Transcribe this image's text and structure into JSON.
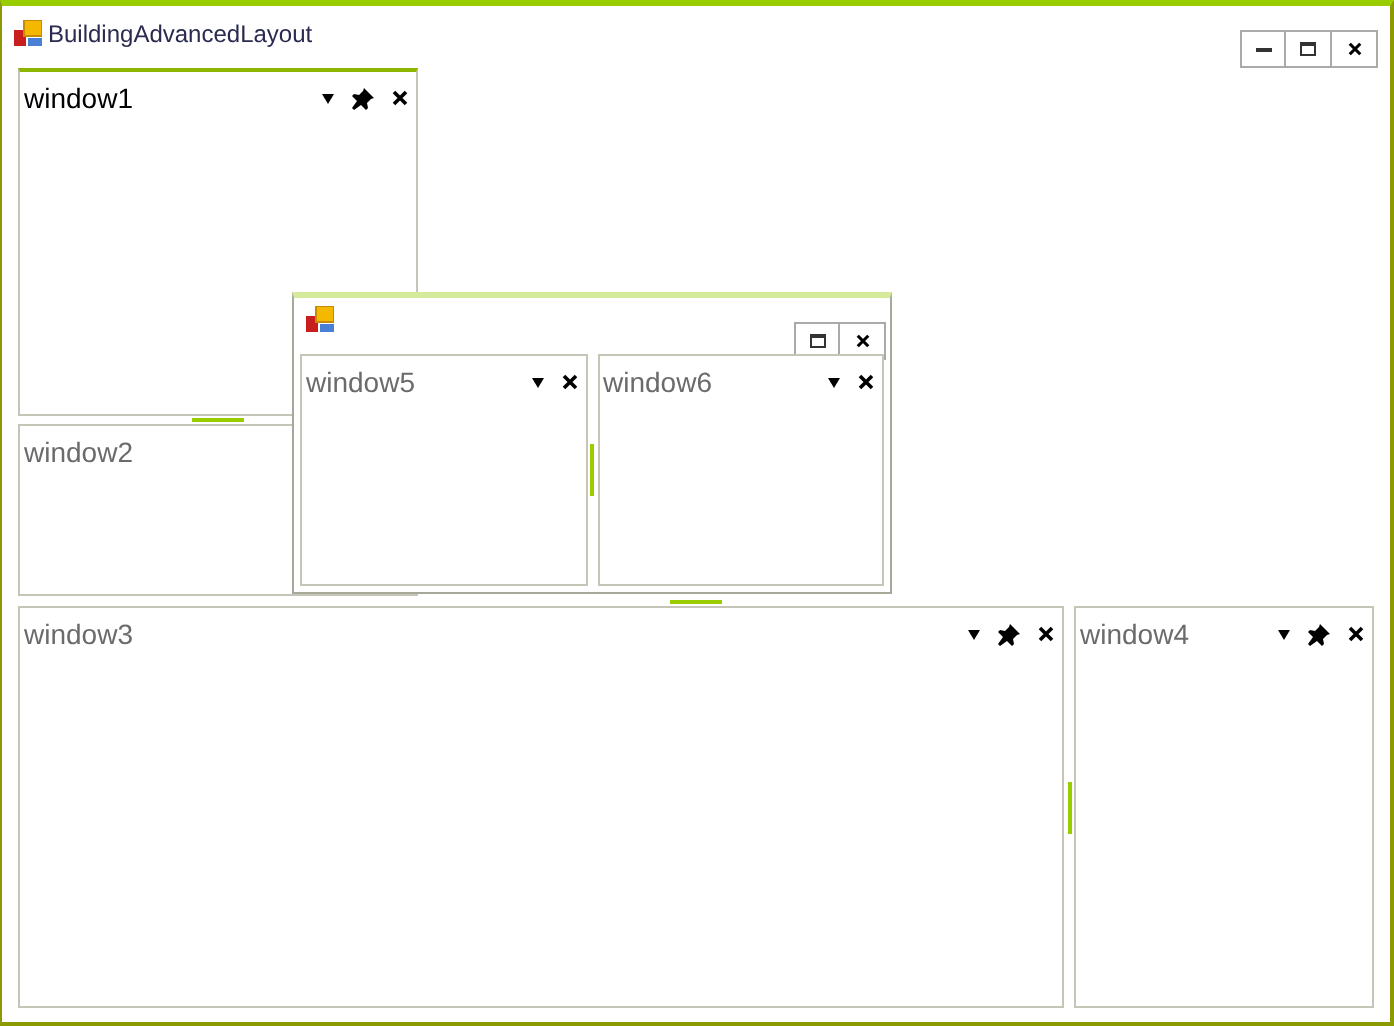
{
  "window": {
    "title": "BuildingAdvancedLayout"
  },
  "docked": {
    "left_top": {
      "title": "window1",
      "active": true,
      "pinnable": true
    },
    "left_bottom": {
      "title": "window2",
      "active": false
    },
    "bottom": [
      {
        "title": "window3",
        "active": false,
        "pinnable": true
      },
      {
        "title": "window4",
        "active": false,
        "pinnable": true
      }
    ]
  },
  "floating": {
    "panes": [
      {
        "title": "window5",
        "active": false,
        "pinnable": false
      },
      {
        "title": "window6",
        "active": false,
        "pinnable": false
      }
    ]
  }
}
